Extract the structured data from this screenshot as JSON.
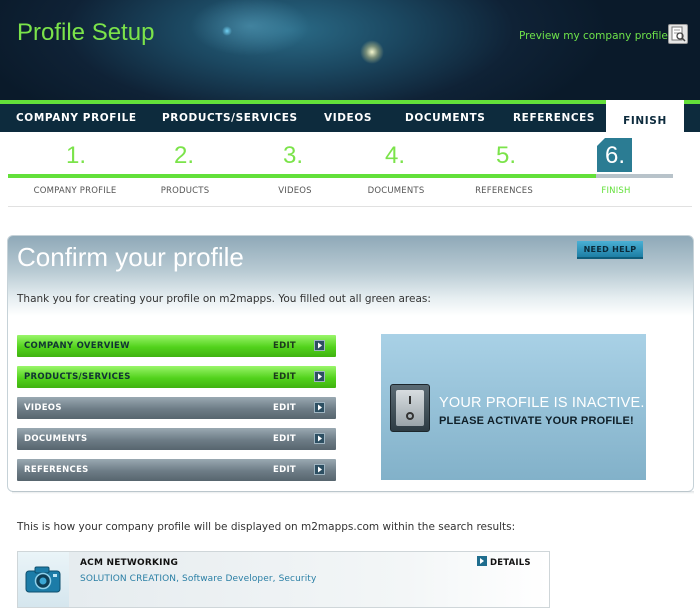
{
  "header": {
    "title": "Profile Setup",
    "preview_label": "Preview my company profile",
    "preview_icon": "document-preview-icon"
  },
  "nav": {
    "items": [
      {
        "label": "COMPANY PROFILE",
        "active": false
      },
      {
        "label": "PRODUCTS/SERVICES",
        "active": false
      },
      {
        "label": "VIDEOS",
        "active": false
      },
      {
        "label": "DOCUMENTS",
        "active": false
      },
      {
        "label": "REFERENCES",
        "active": false
      },
      {
        "label": "FINISH",
        "active": true
      }
    ]
  },
  "steps": [
    {
      "num": "1.",
      "label": "COMPANY PROFILE"
    },
    {
      "num": "2.",
      "label": "PRODUCTS"
    },
    {
      "num": "3.",
      "label": "VIDEOS"
    },
    {
      "num": "4.",
      "label": "DOCUMENTS"
    },
    {
      "num": "5.",
      "label": "REFERENCES"
    },
    {
      "num": "6.",
      "label": "FINISH"
    }
  ],
  "panel": {
    "title": "Confirm your profile",
    "help_label": "NEED HELP",
    "intro": "Thank you for creating your profile on m2mapps. You filled out all green areas:",
    "edit_label": "EDIT",
    "sections": [
      {
        "label": "COMPANY OVERVIEW",
        "state": "complete"
      },
      {
        "label": "PRODUCTS/SERVICES",
        "state": "complete"
      },
      {
        "label": "VIDEOS",
        "state": "empty"
      },
      {
        "label": "DOCUMENTS",
        "state": "empty"
      },
      {
        "label": "REFERENCES",
        "state": "empty"
      }
    ],
    "status_line1": "YOUR PROFILE IS INACTIVE.",
    "status_line2": "PLEASE ACTIVATE YOUR PROFILE!"
  },
  "search_preview": {
    "intro": "This is how your company profile will be displayed on m2mapps.com within the search results:",
    "company": "ACM NETWORKING",
    "details_label": "DETAILS",
    "tags_primary": "SOLUTION CREATION",
    "tags_rest": ", Software Developer, Security"
  },
  "colors": {
    "accent_green": "#63e03a",
    "nav_dark": "#0d2b3d",
    "step6_teal": "#2b7c93",
    "link_blue": "#2a7fa5"
  }
}
